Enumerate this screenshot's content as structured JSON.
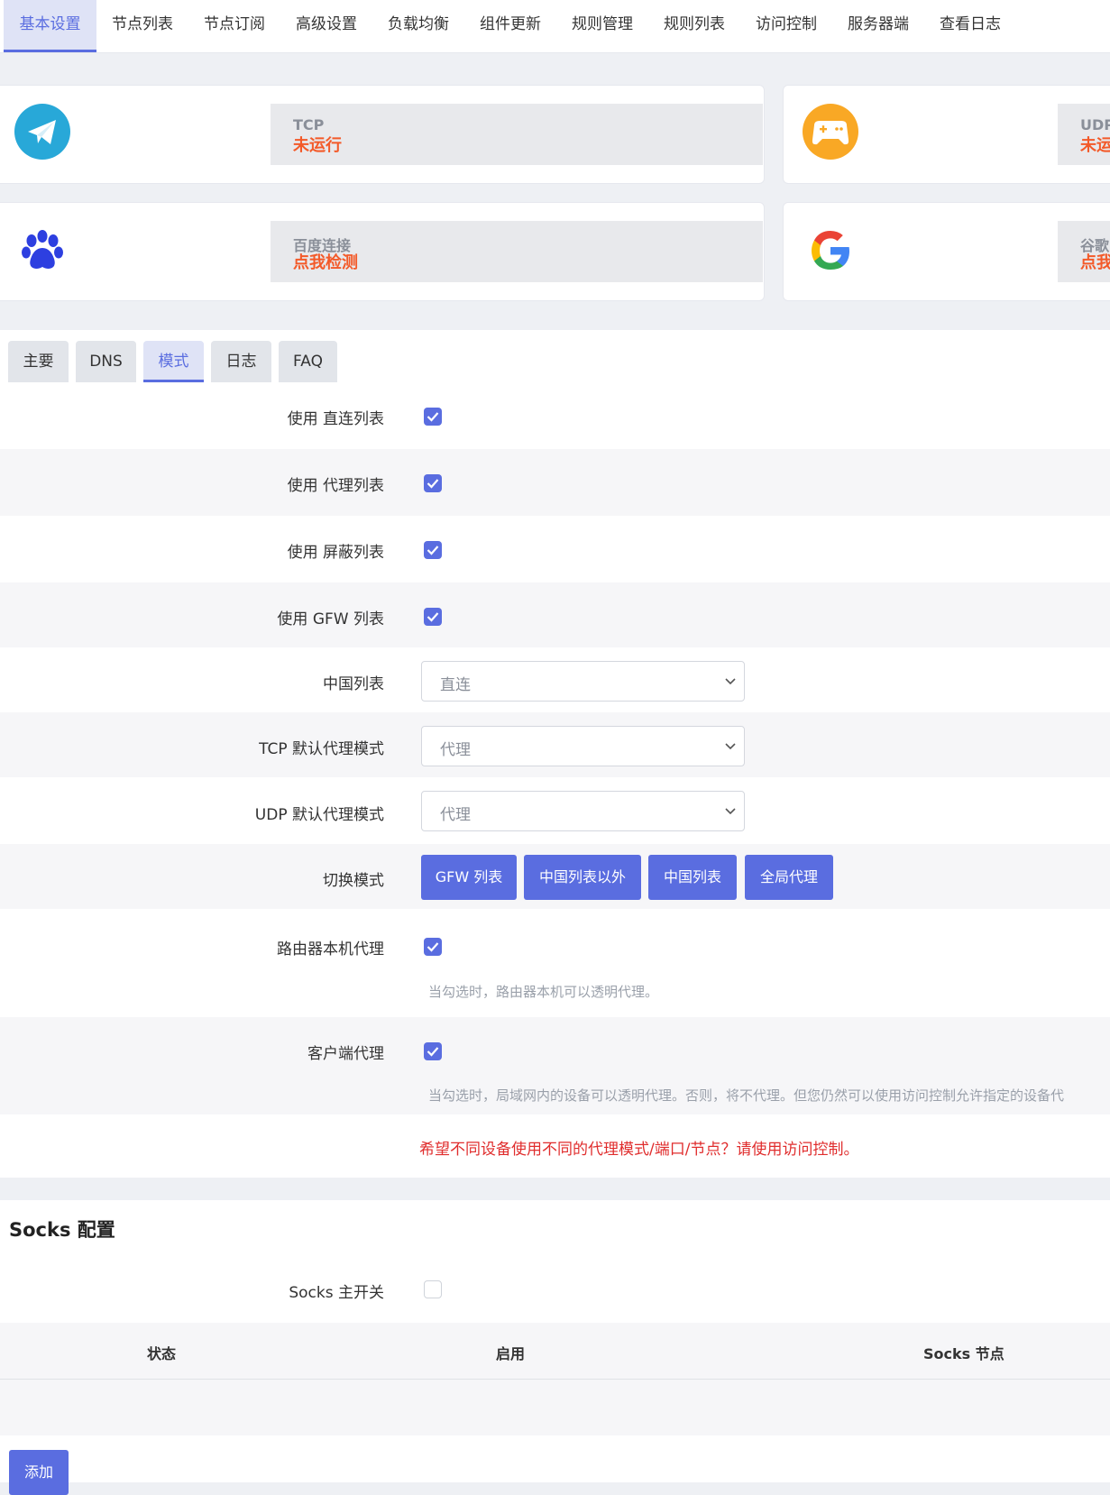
{
  "topnav": {
    "items": [
      {
        "label": "基本设置",
        "active": true
      },
      {
        "label": "节点列表"
      },
      {
        "label": "节点订阅"
      },
      {
        "label": "高级设置"
      },
      {
        "label": "负载均衡"
      },
      {
        "label": "组件更新"
      },
      {
        "label": "规则管理"
      },
      {
        "label": "规则列表"
      },
      {
        "label": "访问控制"
      },
      {
        "label": "服务器端"
      },
      {
        "label": "查看日志"
      }
    ]
  },
  "status": {
    "tcp": {
      "title": "TCP",
      "value": "未运行",
      "icon": "telegram-icon"
    },
    "udp": {
      "title": "UDP",
      "value": "未运",
      "icon": "gamepad-icon"
    },
    "baidu": {
      "title": "百度连接",
      "value": "点我检测",
      "icon": "paw-icon"
    },
    "google": {
      "title": "谷歌",
      "value": "点我",
      "icon": "google-icon"
    }
  },
  "tabs": [
    {
      "label": "主要"
    },
    {
      "label": "DNS"
    },
    {
      "label": "模式",
      "active": true
    },
    {
      "label": "日志"
    },
    {
      "label": "FAQ"
    }
  ],
  "form": {
    "direct_list": {
      "label": "使用 直连列表",
      "checked": true
    },
    "proxy_list": {
      "label": "使用 代理列表",
      "checked": true
    },
    "block_list": {
      "label": "使用 屏蔽列表",
      "checked": true
    },
    "gfw_list": {
      "label": "使用 GFW 列表",
      "checked": true
    },
    "china_list": {
      "label": "中国列表",
      "value": "直连"
    },
    "tcp_mode": {
      "label": "TCP 默认代理模式",
      "value": "代理"
    },
    "udp_mode": {
      "label": "UDP 默认代理模式",
      "value": "代理"
    },
    "switch_mode": {
      "label": "切换模式",
      "buttons": [
        "GFW 列表",
        "中国列表以外",
        "中国列表",
        "全局代理"
      ]
    },
    "router_proxy": {
      "label": "路由器本机代理",
      "checked": true,
      "hint": "当勾选时，路由器本机可以透明代理。"
    },
    "client_proxy": {
      "label": "客户端代理",
      "checked": true,
      "hint": "当勾选时，局域网内的设备可以透明代理。否则，将不代理。但您仍然可以使用访问控制允许指定的设备代"
    },
    "acl_tip": "希望不同设备使用不同的代理模式/端口/节点？请使用访问控制。"
  },
  "socks": {
    "title": "Socks 配置",
    "master_switch": {
      "label": "Socks 主开关",
      "checked": false
    },
    "columns": [
      "状态",
      "启用",
      "Socks 节点"
    ],
    "add_label": "添加"
  },
  "colors": {
    "accent": "#5a6de0",
    "status_red": "#f35a29",
    "warning": "#e02d2d"
  }
}
